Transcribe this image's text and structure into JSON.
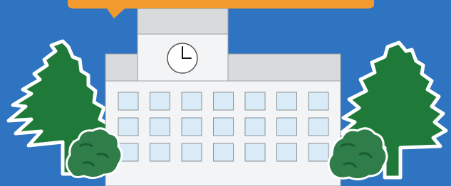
{
  "scene": {
    "colors": {
      "sky": "#2e74c0",
      "speech_bubble": "#f39a2e",
      "building_wall": "#f3f4f6",
      "building_roof": "#d9dadc",
      "window": "#d8ebf7",
      "tree_green": "#1f7a3a",
      "bush_green": "#2f7d49",
      "outline": "#ffffff"
    },
    "clock": {
      "time": "3:00",
      "icon": "clock-icon"
    },
    "windows": {
      "rows": 3,
      "columns": 7
    },
    "trees": [
      "left-pine-tree",
      "right-pine-tree"
    ],
    "bushes": [
      "left-bush",
      "right-bush"
    ]
  }
}
